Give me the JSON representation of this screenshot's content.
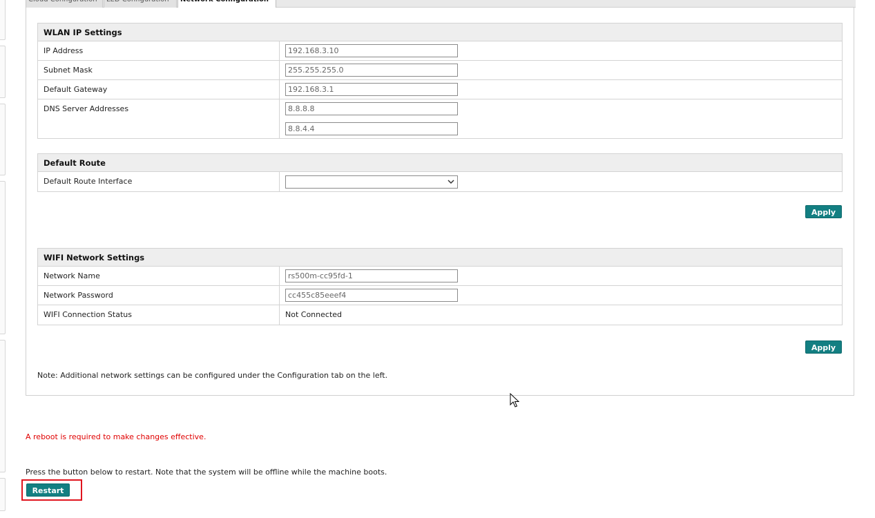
{
  "tabs": [
    "Cloud Configuration",
    "LED Configuration",
    "Network Configuration"
  ],
  "wlan": {
    "title": "WLAN IP Settings",
    "ip_label": "IP Address",
    "ip_value": "192.168.3.10",
    "mask_label": "Subnet Mask",
    "mask_value": "255.255.255.0",
    "gateway_label": "Default Gateway",
    "gateway_value": "192.168.3.1",
    "dns_label": "DNS Server Addresses",
    "dns1_value": "8.8.8.8",
    "dns2_value": "8.8.4.4"
  },
  "route": {
    "title": "Default Route",
    "interface_label": "Default Route Interface",
    "interface_value": "",
    "apply_label": "Apply"
  },
  "wifi": {
    "title": "WIFI Network Settings",
    "name_label": "Network Name",
    "name_value": "rs500m-cc95fd-1",
    "password_label": "Network Password",
    "password_value": "cc455c85eeef4",
    "status_label": "WIFI Connection Status",
    "status_value": "Not Connected",
    "apply_label": "Apply"
  },
  "note": "Note: Additional network settings can be configured under the Configuration tab on the left.",
  "reboot_message": "A reboot is required to make changes effective.",
  "restart_message": "Press the button below to restart. Note that the system will be offline while the machine boots.",
  "restart_label": "Restart",
  "colors": {
    "accent": "#137f82",
    "warning": "#e00000",
    "highlight": "#e0141e"
  }
}
